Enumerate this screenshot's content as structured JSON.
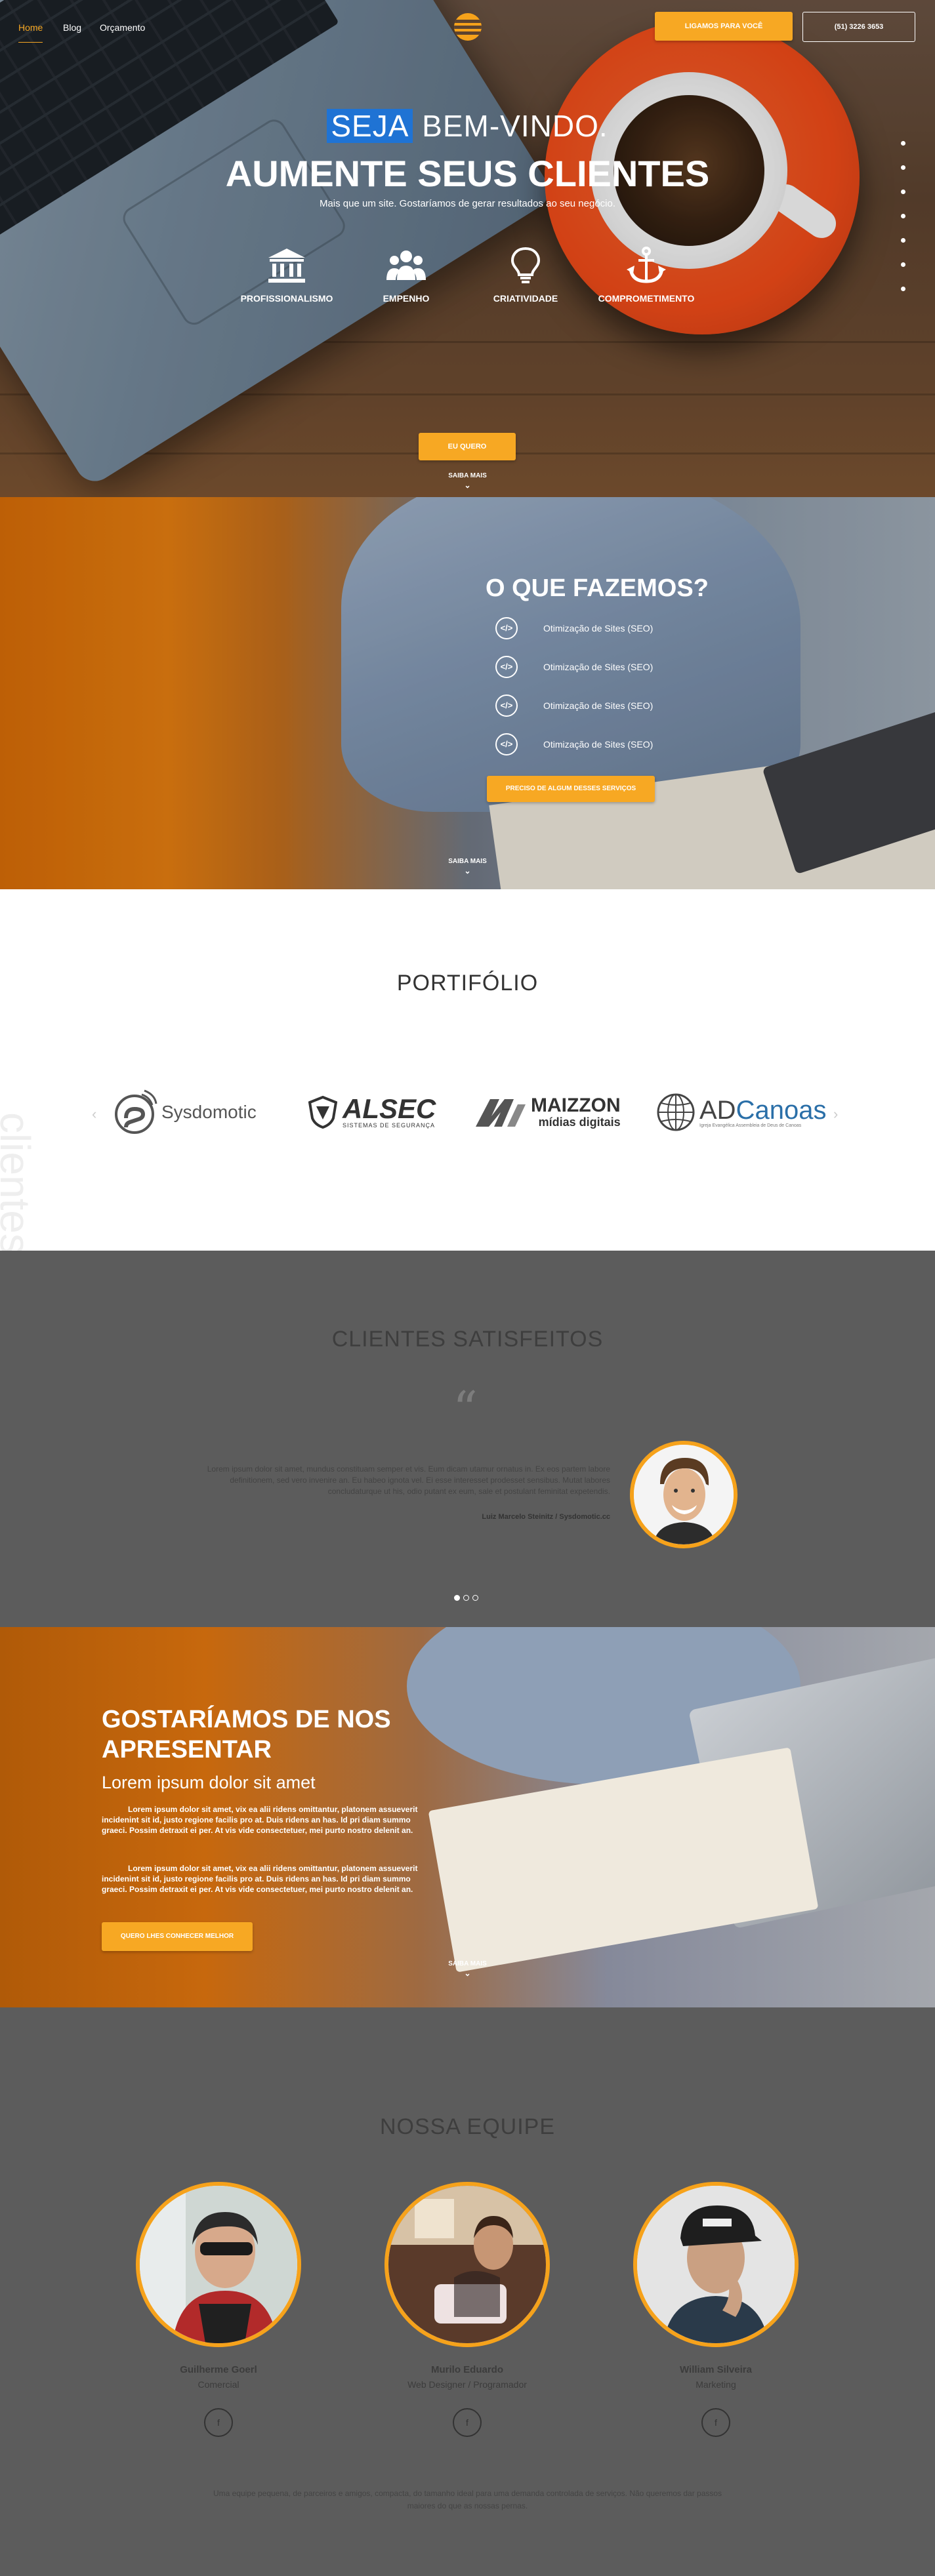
{
  "nav": {
    "links": [
      "Home",
      "Blog",
      "Orçamento"
    ],
    "cta_call": "LIGAMOS PARA VOCÊ",
    "phone": "(51) 3226 3653"
  },
  "hero": {
    "kicker_highlight": "SEJA",
    "kicker_rest": "BEM-VINDO.",
    "title": "AUMENTE SEUS CLIENTES",
    "subtitle": "Mais que um site. Gostaríamos de gerar resultados ao seu negócio.",
    "features": [
      {
        "icon": "bank-icon",
        "label": "PROFISSIONALISMO"
      },
      {
        "icon": "team-icon",
        "label": "EMPENHO"
      },
      {
        "icon": "lightbulb-icon",
        "label": "CRIATIVIDADE"
      },
      {
        "icon": "anchor-icon",
        "label": "COMPROMETIMENTO"
      }
    ],
    "button": "EU QUERO",
    "more": "SAIBA MAIS"
  },
  "services": {
    "title": "O QUE FAZEMOS?",
    "items": [
      "Otimização de Sites (SEO)",
      "Otimização de Sites (SEO)",
      "Otimização de Sites (SEO)",
      "Otimização de Sites (SEO)"
    ],
    "item_icon": "code-icon",
    "button": "PRECISO DE ALGUM DESSES SERVIÇOS",
    "more": "SAIBA MAIS"
  },
  "portfolio": {
    "title": "PORTIFÓLIO",
    "watermark": "clientes",
    "logos": [
      {
        "name": "Sysdomotic"
      },
      {
        "name": "ALSEC",
        "tagline": "SISTEMAS DE SEGURANÇA"
      },
      {
        "name": "MAIZZON",
        "tagline": "mídias digitais"
      },
      {
        "name": "ADCanoas",
        "prefix": "AD",
        "suffix": "Canoas",
        "tagline": "Igreja Evangélica Assembleia de Deus de Canoas"
      }
    ]
  },
  "testimonials": {
    "title": "CLIENTES SATISFEITOS",
    "text": "Lorem ipsum dolor sit amet, mundus constituam semper et vis. Eum dicam utamur ornatus in. Ex eos partem labore definitionem, sed vero invenire an. Eu habeo ignota vel. Ei esse interesset prodesset sensibus. Mutat labores concludaturque ut his, odio putant ex eum, sale et postulant feminitat expetendis.",
    "author": "Luiz Marcelo Steinitz / Sysdomotic.cc",
    "pages": 3,
    "active_page": 1
  },
  "about": {
    "title": "GOSTARÍAMOS DE NOS APRESENTAR",
    "subtitle": "Lorem ipsum dolor sit amet",
    "paragraphs": [
      "Lorem ipsum dolor sit amet, vix ea alii ridens omittantur, platonem assueverit incidenint sit id, justo regione facilis pro at. Duis ridens an has. Id pri diam summo graeci. Possim detraxit ei per. At vis vide consectetuer, mei purto nostro delenit an.",
      "Lorem ipsum dolor sit amet, vix ea alii ridens omittantur, platonem assueverit incidenint sit id, justo regione facilis pro at. Duis ridens an has. Id pri diam summo graeci. Possim detraxit ei per. At vis vide consectetuer, mei purto nostro delenit an."
    ],
    "button": "QUERO LHES CONHECER MELHOR",
    "more": "SAIBA MAIS"
  },
  "team": {
    "title": "NOSSA EQUIPE",
    "members": [
      {
        "name": "Guilherme Goerl",
        "role": "Comercial"
      },
      {
        "name": "Murilo Eduardo",
        "role": "Web Designer / Programador"
      },
      {
        "name": "William Silveira",
        "role": "Marketing"
      }
    ],
    "social_label": "f",
    "footer": "Uma equipe pequena, de parceiros e amigos, compacta, do tamanho ideal para uma demanda controlada de serviços. Não queremos dar passos maiores do que as nossas pernas."
  },
  "colors": {
    "accent": "#f7a823",
    "highlight": "#1f73d4",
    "dark_bg": "#5c5c5c"
  }
}
